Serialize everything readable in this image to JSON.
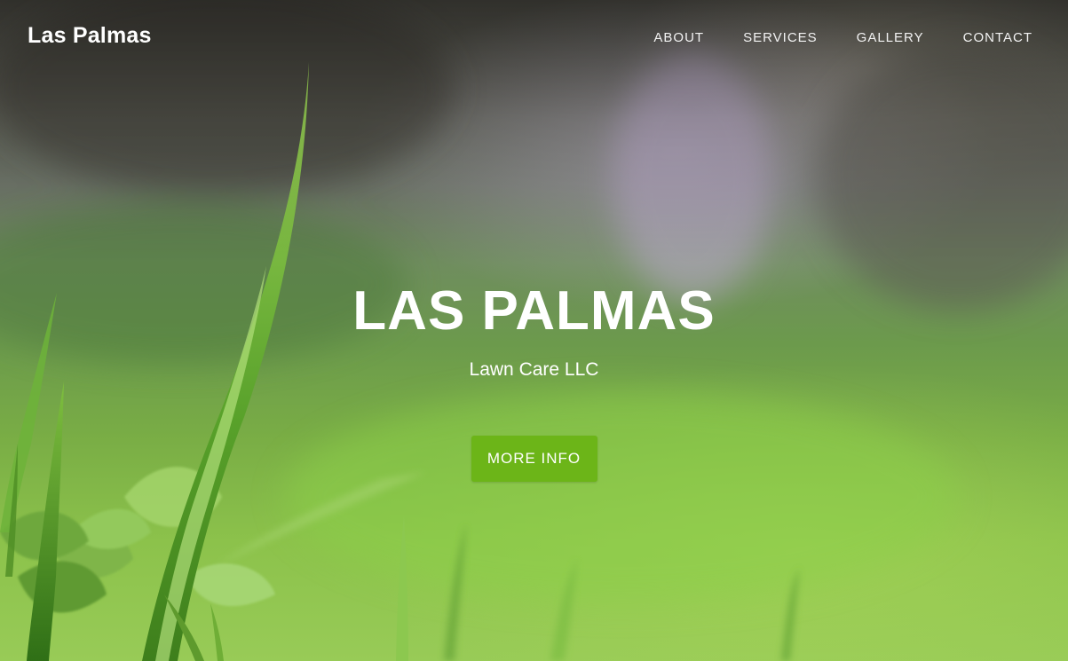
{
  "navbar": {
    "brand": "Las Palmas",
    "links": [
      {
        "label": "ABOUT"
      },
      {
        "label": "SERVICES"
      },
      {
        "label": "GALLERY"
      },
      {
        "label": "CONTACT"
      }
    ]
  },
  "hero": {
    "title": "LAS PALMAS",
    "subtitle": "Lawn Care LLC",
    "cta_label": "MORE INFO",
    "background_image": "grass-closeup-photo"
  },
  "colors": {
    "accent": "#6cb518",
    "text": "#ffffff"
  }
}
